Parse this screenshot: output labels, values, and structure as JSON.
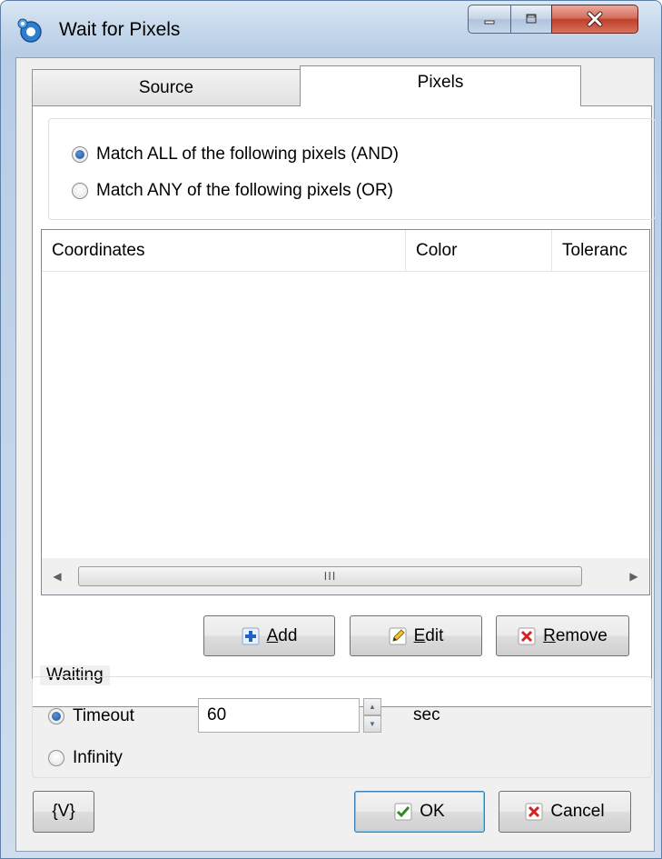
{
  "window": {
    "title": "Wait for Pixels"
  },
  "tabs": [
    {
      "label": "Source"
    },
    {
      "label": "Pixels"
    }
  ],
  "match": {
    "all_label": "Match ALL of the following pixels (AND)",
    "any_label": "Match ANY of the following pixels (OR)",
    "selected": "all"
  },
  "table": {
    "columns": [
      "Coordinates",
      "Color",
      "Toleranc"
    ],
    "rows": [],
    "scroll_thumb_label": "III"
  },
  "actions": {
    "add": {
      "label": "Add",
      "accel": "A",
      "rest": "dd",
      "icon": "plus-icon"
    },
    "edit": {
      "label": "Edit",
      "accel": "E",
      "rest": "dit",
      "icon": "pencil-icon"
    },
    "remove": {
      "label": "Remove",
      "accel": "R",
      "rest": "emove",
      "icon": "x-icon"
    }
  },
  "waiting": {
    "group_label": "Waiting",
    "timeout_label": "Timeout",
    "timeout_value": "60",
    "unit": "sec",
    "infinity_label": "Infinity",
    "selected": "timeout"
  },
  "footer": {
    "variables_label": "{V}",
    "ok_label": "OK",
    "cancel_label": "Cancel"
  },
  "colors": {
    "radio_selected": "#1c4f9a",
    "plus_icon": "#1e64c8",
    "close_red": "#c0402b",
    "check_green": "#2e8b1e",
    "x_red": "#d22222"
  }
}
